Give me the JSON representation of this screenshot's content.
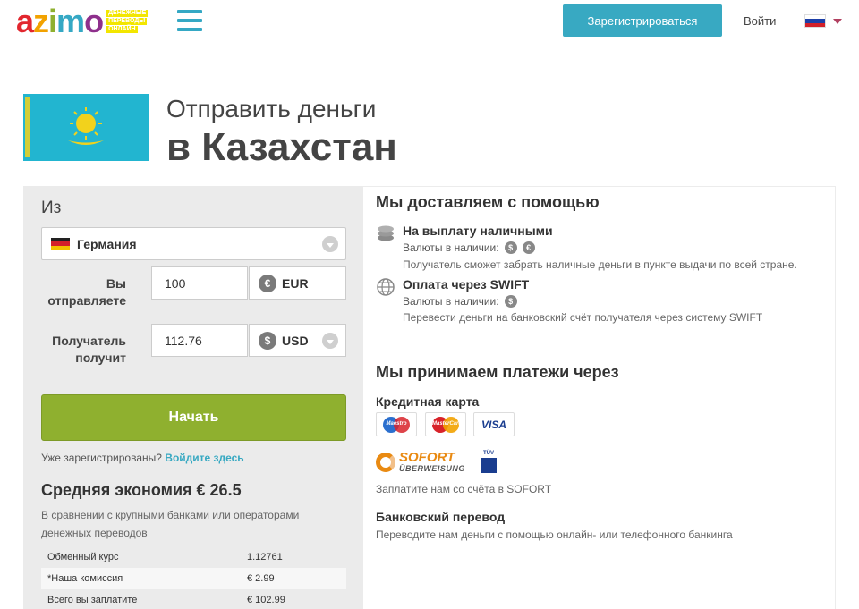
{
  "header": {
    "logo_text": "azimo",
    "logo_tagline": [
      "ДЕНЕЖНЫЕ",
      "ПЕРЕВОДЫ",
      "ОНЛАЙН"
    ],
    "register_label": "Зарегистрироваться",
    "login_label": "Войти",
    "language_flag": "ru-flag-icon"
  },
  "title": {
    "line1": "Отправить деньги",
    "line2": "в Казахстан",
    "flag": "kazakhstan-flag-icon"
  },
  "form": {
    "from_label": "Из",
    "country": "Германия",
    "send_label_1": "Вы",
    "send_label_2": "отправляете",
    "send_amount": "100",
    "send_currency_symbol": "€",
    "send_currency": "EUR",
    "receive_label_1": "Получатель",
    "receive_label_2": "получит",
    "receive_amount": "112.76",
    "receive_currency_symbol": "$",
    "receive_currency": "USD",
    "start_label": "Начать",
    "registered_text": "Уже зарегистрированы?",
    "login_here": "Войдите здесь"
  },
  "savings": {
    "title": "Средняя экономия € 26.5",
    "desc": "В сравнении с крупными банками или операторами денежных переводов",
    "rows": [
      {
        "label": "Обменный курс",
        "value": "1.12761"
      },
      {
        "label": "*Наша комиссия",
        "value": "€ 2.99"
      },
      {
        "label": "Всего вы заплатите",
        "value": "€ 102.99"
      }
    ]
  },
  "delivery": {
    "title": "Мы доставляем с помощью",
    "methods": [
      {
        "name": "На выплату наличными",
        "currencies_label": "Валюты в наличии:",
        "currency_symbols": [
          "$",
          "€"
        ],
        "desc": "Получатель сможет забрать наличные деньги в пункте выдачи по всей стране."
      },
      {
        "name": "Оплата через SWIFT",
        "currencies_label": "Валюты в наличии:",
        "currency_symbols": [
          "$"
        ],
        "desc": "Перевести деньги на банковский счёт получателя через систему SWIFT"
      }
    ]
  },
  "payments": {
    "title": "Мы принимаем платежи через",
    "card_title": "Кредитная карта",
    "cards": [
      "Maestro",
      "MasterCard",
      "VISA"
    ],
    "sofort_line1": "SOFORT",
    "sofort_line2": "ÜBERWEISUNG",
    "tuv_label": "TÜV",
    "sofort_desc": "Заплатите нам со счёта в SOFORT",
    "bank_title": "Банковский перевод",
    "bank_desc": "Переводите нам деньги с помощью онлайн- или телефонного банкинга"
  },
  "colors": {
    "accent": "#38a9c2",
    "start_button": "#8fb02f",
    "sofort": "#e98a12"
  }
}
